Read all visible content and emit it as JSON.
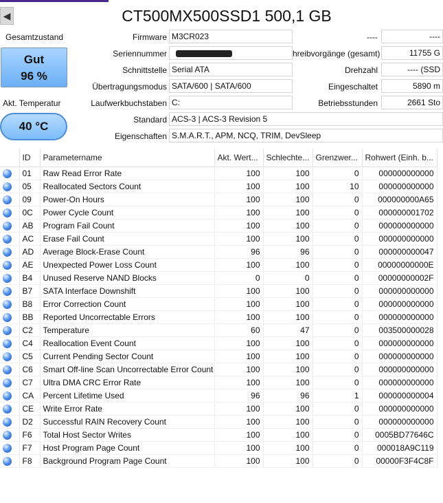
{
  "header": {
    "prev_icon": "triangle-left-icon",
    "prev_glyph": "◀",
    "title": "CT500MX500SSD1 500,1 GB"
  },
  "health": {
    "label": "Gesamtzustand",
    "status": "Gut",
    "percent": "96 %",
    "color": "#7dbef7"
  },
  "temperature": {
    "label": "Akt. Temperatur",
    "value": "40 °C"
  },
  "info_left": [
    {
      "label": "Firmware",
      "value": "M3CR023"
    },
    {
      "label": "Seriennummer",
      "value": ""
    },
    {
      "label": "Schnittstelle",
      "value": "Serial ATA"
    },
    {
      "label": "Übertragungsmodus",
      "value": "SATA/600 | SATA/600"
    },
    {
      "label": "Laufwerkbuchstaben",
      "value": "C:"
    },
    {
      "label": "Standard",
      "value": "ACS-3 | ACS-3 Revision 5"
    },
    {
      "label": "Eigenschaften",
      "value": "S.M.A.R.T., APM, NCQ, TRIM, DevSleep"
    }
  ],
  "info_right": [
    {
      "label": "----",
      "value": "----"
    },
    {
      "label": "hreibvorgänge (gesamt)",
      "value": "11755 G"
    },
    {
      "label": "Drehzahl",
      "value": "---- (SSD"
    },
    {
      "label": "Eingeschaltet",
      "value": "5890 m"
    },
    {
      "label": "Betriebsstunden",
      "value": "2661 Sto"
    }
  ],
  "smart": {
    "columns": [
      "",
      "ID",
      "Parametername",
      "Akt. Wert...",
      "Schlechte...",
      "Grenzwer...",
      "Rohwert (Einh. b..."
    ],
    "status_icon": "blue-status-dot-icon",
    "rows": [
      [
        "01",
        "Raw Read Error Rate",
        "100",
        "100",
        "0",
        "000000000000"
      ],
      [
        "05",
        "Reallocated Sectors Count",
        "100",
        "100",
        "10",
        "000000000000"
      ],
      [
        "09",
        "Power-On Hours",
        "100",
        "100",
        "0",
        "000000000A65"
      ],
      [
        "0C",
        "Power Cycle Count",
        "100",
        "100",
        "0",
        "000000001702"
      ],
      [
        "AB",
        "Program Fail Count",
        "100",
        "100",
        "0",
        "000000000000"
      ],
      [
        "AC",
        "Erase Fail Count",
        "100",
        "100",
        "0",
        "000000000000"
      ],
      [
        "AD",
        "Average Block-Erase Count",
        "96",
        "96",
        "0",
        "000000000047"
      ],
      [
        "AE",
        "Unexpected Power Loss Count",
        "100",
        "100",
        "0",
        "00000000000E"
      ],
      [
        "B4",
        "Unused Reserve NAND Blocks",
        "0",
        "0",
        "0",
        "00000000002F"
      ],
      [
        "B7",
        "SATA Interface Downshift",
        "100",
        "100",
        "0",
        "000000000000"
      ],
      [
        "B8",
        "Error Correction Count",
        "100",
        "100",
        "0",
        "000000000000"
      ],
      [
        "BB",
        "Reported Uncorrectable Errors",
        "100",
        "100",
        "0",
        "000000000000"
      ],
      [
        "C2",
        "Temperature",
        "60",
        "47",
        "0",
        "003500000028"
      ],
      [
        "C4",
        "Reallocation Event Count",
        "100",
        "100",
        "0",
        "000000000000"
      ],
      [
        "C5",
        "Current Pending Sector Count",
        "100",
        "100",
        "0",
        "000000000000"
      ],
      [
        "C6",
        "Smart Off-line Scan Uncorrectable Error Count",
        "100",
        "100",
        "0",
        "000000000000"
      ],
      [
        "C7",
        "Ultra DMA CRC Error Rate",
        "100",
        "100",
        "0",
        "000000000000"
      ],
      [
        "CA",
        "Percent Lifetime Used",
        "96",
        "96",
        "1",
        "000000000004"
      ],
      [
        "CE",
        "Write Error Rate",
        "100",
        "100",
        "0",
        "000000000000"
      ],
      [
        "D2",
        "Successful RAIN Recovery Count",
        "100",
        "100",
        "0",
        "000000000000"
      ],
      [
        "F6",
        "Total Host Sector Writes",
        "100",
        "100",
        "0",
        "0005BD77646C"
      ],
      [
        "F7",
        "Host Program Page Count",
        "100",
        "100",
        "0",
        "000018A9C119"
      ],
      [
        "F8",
        "Background Program Page Count",
        "100",
        "100",
        "0",
        "00000F3F4C8F"
      ]
    ]
  }
}
